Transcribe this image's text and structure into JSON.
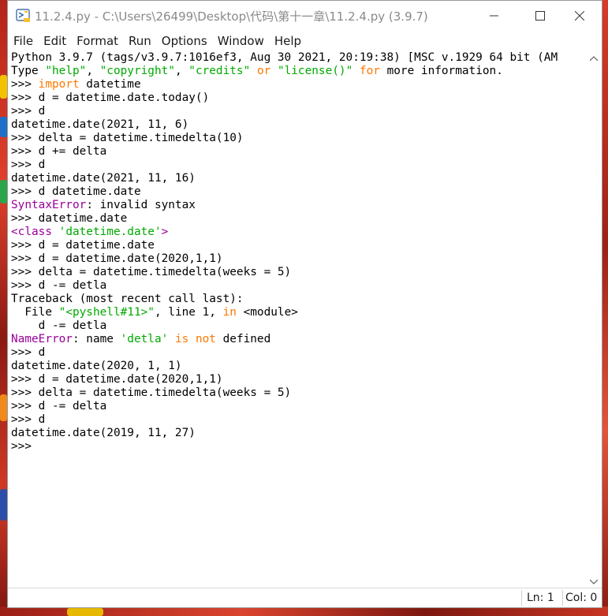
{
  "window": {
    "title": "11.2.4.py - C:\\Users\\26499\\Desktop\\代码\\第十一章\\11.2.4.py (3.9.7)"
  },
  "menu": [
    "File",
    "Edit",
    "Format",
    "Run",
    "Options",
    "Window",
    "Help"
  ],
  "shell_lines": [
    [
      [
        "out",
        "Python 3.9.7 (tags/v3.9.7:1016ef3, Aug 30 2021, 20:19:38) [MSC v.1929 64 bit (AM"
      ]
    ],
    [
      [
        "out",
        "Type "
      ],
      [
        "str",
        "\"help\""
      ],
      [
        "out",
        ", "
      ],
      [
        "str",
        "\"copyright\""
      ],
      [
        "out",
        ", "
      ],
      [
        "str",
        "\"credits\""
      ],
      [
        "out",
        " "
      ],
      [
        "kw",
        "or"
      ],
      [
        "out",
        " "
      ],
      [
        "str",
        "\"license()\""
      ],
      [
        "out",
        " "
      ],
      [
        "kw",
        "for"
      ],
      [
        "out",
        " more information."
      ]
    ],
    [
      [
        "out",
        ">>> "
      ],
      [
        "kw",
        "import"
      ],
      [
        "out",
        " datetime"
      ]
    ],
    [
      [
        "out",
        ">>> d = datetime.date.today()"
      ]
    ],
    [
      [
        "out",
        ">>> d"
      ]
    ],
    [
      [
        "out",
        "datetime.date(2021, 11, 6)"
      ]
    ],
    [
      [
        "out",
        ">>> delta = datetime.timedelta(10)"
      ]
    ],
    [
      [
        "out",
        ">>> d += delta"
      ]
    ],
    [
      [
        "out",
        ">>> d"
      ]
    ],
    [
      [
        "out",
        "datetime.date(2021, 11, 16)"
      ]
    ],
    [
      [
        "out",
        ">>> d datetime.date"
      ]
    ],
    [
      [
        "err",
        "SyntaxError"
      ],
      [
        "out",
        ": invalid syntax"
      ]
    ],
    [
      [
        "out",
        ">>> datetime.date"
      ]
    ],
    [
      [
        "err",
        "<class "
      ],
      [
        "str",
        "'datetime.date'"
      ],
      [
        "err",
        ">"
      ]
    ],
    [
      [
        "out",
        ">>> d = datetime.date"
      ]
    ],
    [
      [
        "out",
        ">>> d = datetime.date(2020,1,1)"
      ]
    ],
    [
      [
        "out",
        ">>> delta = datetime.timedelta(weeks = 5)"
      ]
    ],
    [
      [
        "out",
        ">>> d -= detla"
      ]
    ],
    [
      [
        "out",
        "Traceback (most recent call last):"
      ]
    ],
    [
      [
        "out",
        "  File "
      ],
      [
        "str",
        "\"<pyshell#11>\""
      ],
      [
        "out",
        ", line 1, "
      ],
      [
        "kw",
        "in"
      ],
      [
        "out",
        " <module>"
      ]
    ],
    [
      [
        "out",
        "    d -= detla"
      ]
    ],
    [
      [
        "err",
        "NameError"
      ],
      [
        "out",
        ": name "
      ],
      [
        "str",
        "'detla'"
      ],
      [
        "out",
        " "
      ],
      [
        "kw",
        "is not"
      ],
      [
        "out",
        " defined"
      ]
    ],
    [
      [
        "out",
        ">>> d"
      ]
    ],
    [
      [
        "out",
        "datetime.date(2020, 1, 1)"
      ]
    ],
    [
      [
        "out",
        ">>> d = datetime.date(2020,1,1)"
      ]
    ],
    [
      [
        "out",
        ">>> delta = datetime.timedelta(weeks = 5)"
      ]
    ],
    [
      [
        "out",
        ">>> d -= delta"
      ]
    ],
    [
      [
        "out",
        ">>> d"
      ]
    ],
    [
      [
        "out",
        "datetime.date(2019, 11, 27)"
      ]
    ],
    [
      [
        "out",
        ">>> "
      ]
    ]
  ],
  "status": {
    "line": "Ln: 1",
    "col": "Col: 0"
  },
  "colors": {
    "keyword": "#ff7700",
    "string": "#00aa00",
    "error": "#990099",
    "text": "#000000"
  },
  "icons": {
    "app": "python-idle-icon",
    "minimize": "minimize-icon",
    "maximize": "maximize-icon",
    "close": "close-icon"
  }
}
